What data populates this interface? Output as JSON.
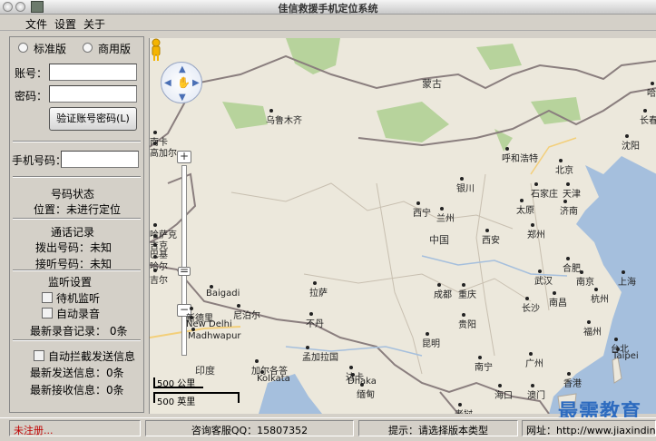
{
  "window": {
    "title": "佳信救援手机定位系统"
  },
  "menu": {
    "items": [
      "文件",
      "设置",
      "关于"
    ]
  },
  "left_panel": {
    "edition": {
      "standard": "标准版",
      "commercial": "商用版"
    },
    "account_label": "账号：",
    "password_label": "密码：",
    "verify_button": "验证账号密码(L)",
    "phone_label": "手机号码：",
    "status_title": "号码状态",
    "position_text": "位置：未进行定位",
    "call_title": "通话记录",
    "dial_text": "拨出号码：未知",
    "answer_text": "接听号码：未知",
    "monitor_title": "监听设置",
    "monitor_check": "待机监听",
    "record_check": "自动录音",
    "latest_record": "最新录音记录：  0条",
    "intercept_check": "自动拦截发送信息",
    "latest_sent": "最新发送信息：0条",
    "latest_received": "最新接收信息：0条"
  },
  "map": {
    "cities": [
      {
        "name": "蒙古",
        "big": true
      },
      {
        "name": "乌鲁木齐"
      },
      {
        "name": "呼和浩特"
      },
      {
        "name": "沈阳"
      },
      {
        "name": "长春"
      },
      {
        "name": "北京"
      },
      {
        "name": "银川"
      },
      {
        "name": "石家庄"
      },
      {
        "name": "天津"
      },
      {
        "name": "西宁"
      },
      {
        "name": "兰州"
      },
      {
        "name": "太原"
      },
      {
        "name": "济南"
      },
      {
        "name": "中国",
        "big": true
      },
      {
        "name": "西安"
      },
      {
        "name": "郑州"
      },
      {
        "name": "合肥"
      },
      {
        "name": "南京"
      },
      {
        "name": "上海"
      },
      {
        "name": "拉萨"
      },
      {
        "name": "成都"
      },
      {
        "name": "重庆"
      },
      {
        "name": "武汉"
      },
      {
        "name": "杭州"
      },
      {
        "name": "长沙"
      },
      {
        "name": "南昌"
      },
      {
        "name": "贵阳"
      },
      {
        "name": "福州"
      },
      {
        "name": "昆明"
      },
      {
        "name": "台北"
      },
      {
        "name": "南宁"
      },
      {
        "name": "广州"
      },
      {
        "name": "香港"
      },
      {
        "name": "海口"
      },
      {
        "name": "澳门"
      },
      {
        "name": "印度",
        "big": true
      },
      {
        "name": "尼泊尔"
      },
      {
        "name": "不丹"
      },
      {
        "name": "孟加拉国"
      },
      {
        "name": "加尔各答"
      },
      {
        "name": "达卡"
      },
      {
        "name": "缅甸"
      },
      {
        "name": "老挝"
      },
      {
        "name": "新德里"
      },
      {
        "name": "Baigadi"
      },
      {
        "name": "New Delhi"
      },
      {
        "name": "Madhwapur"
      },
      {
        "name": "Kolkata"
      },
      {
        "name": "Dhaka"
      },
      {
        "name": "南卡"
      },
      {
        "name": "高加尔"
      },
      {
        "name": "巴基"
      },
      {
        "name": "哈尔"
      },
      {
        "name": "吉尔"
      },
      {
        "name": "哈萨克"
      },
      {
        "name": "吉克"
      },
      {
        "name": "哈"
      },
      {
        "name": "Taipei"
      }
    ],
    "scale": {
      "km": "500 公里",
      "mi": "500 英里"
    }
  },
  "statusbar": {
    "unregistered": "未注册...",
    "qq": "咨询客服QQ：15807352",
    "hint": "提示：请选择版本类型",
    "website": "网址：http://www.jiaxindin"
  },
  "watermark": "最需教育",
  "colors": {
    "water": "#a5bfdd",
    "land": "#ece8dc",
    "park": "#b7d39c",
    "border": "#8a7e7e",
    "road": "#f3cf7a"
  }
}
